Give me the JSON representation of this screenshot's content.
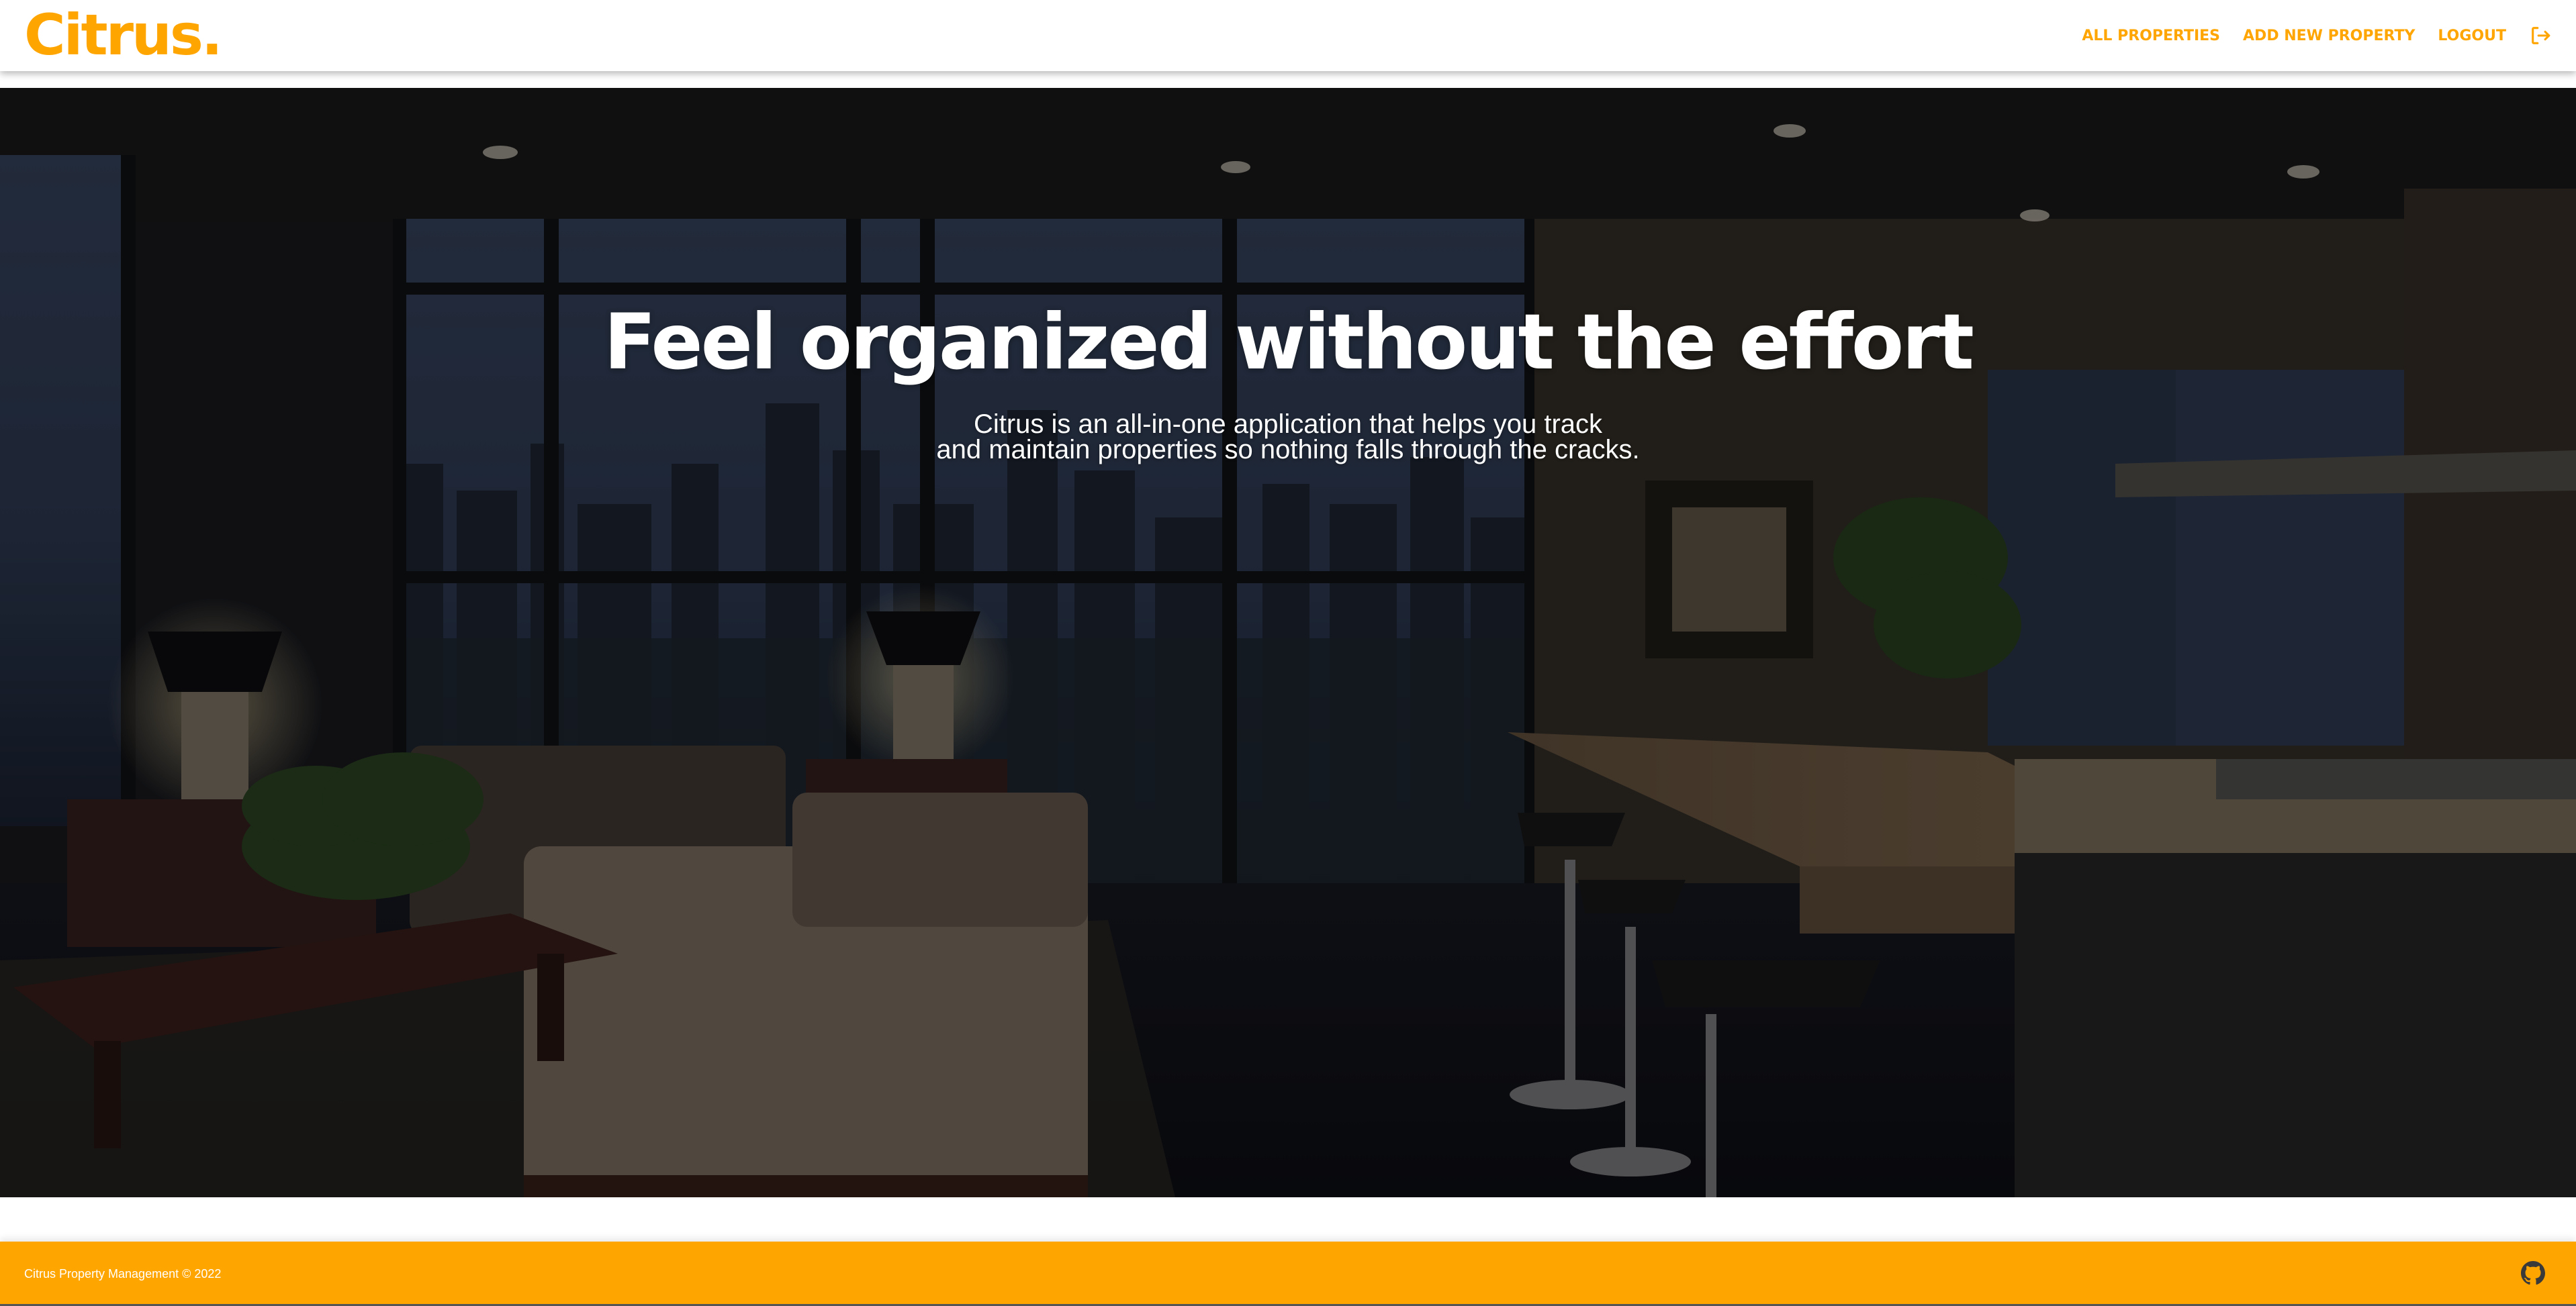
{
  "brand": {
    "logo_text": "Citrus.",
    "accent_color": "#ffa500"
  },
  "nav": {
    "items": [
      {
        "label": "ALL PROPERTIES"
      },
      {
        "label": "ADD NEW PROPERTY"
      },
      {
        "label": "LOGOUT"
      }
    ],
    "logout_icon": "logout-icon"
  },
  "hero": {
    "title": "Feel organized without the effort",
    "subtitle_line1": "Citrus is an all-in-one application that helps you track",
    "subtitle_line2": "and maintain properties so nothing falls through the cracks.",
    "background": "dimmed photo of a modern apartment living room and kitchen with city view at dusk"
  },
  "footer": {
    "copyright": "Citrus Property Management © 2022",
    "github_icon": "github-icon",
    "background_color": "#ffa500"
  }
}
